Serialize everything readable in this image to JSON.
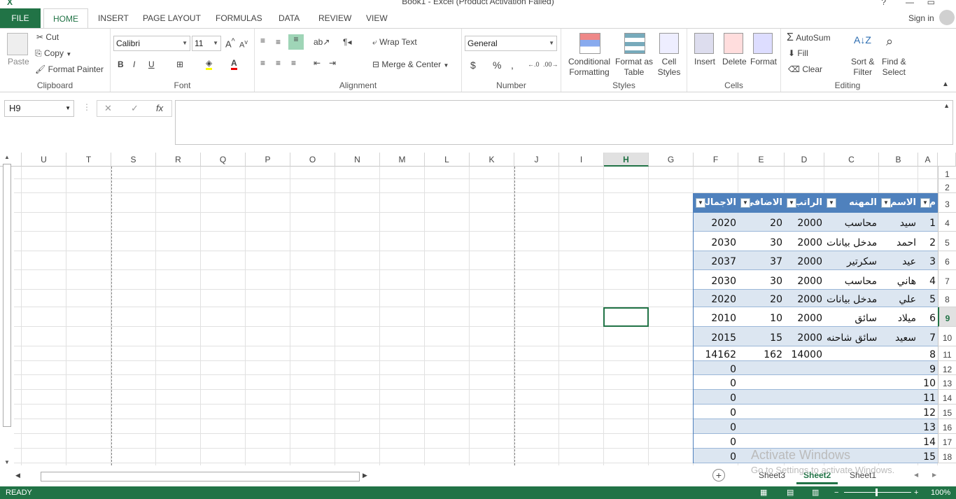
{
  "window": {
    "title": "Book1 - Excel (Product Activation Failed)"
  },
  "tabs": {
    "file": "FILE",
    "home": "HOME",
    "insert": "INSERT",
    "page_layout": "PAGE LAYOUT",
    "formulas": "FORMULAS",
    "data": "DATA",
    "review": "REVIEW",
    "view": "VIEW",
    "sign_in": "Sign in"
  },
  "ribbon": {
    "clipboard": {
      "label": "Clipboard",
      "paste": "Paste",
      "cut": "Cut",
      "copy": "Copy",
      "format_painter": "Format Painter"
    },
    "font": {
      "label": "Font",
      "family": "Calibri",
      "size": "11"
    },
    "alignment": {
      "label": "Alignment",
      "wrap": "Wrap Text",
      "merge": "Merge & Center"
    },
    "number": {
      "label": "Number",
      "format": "General"
    },
    "styles": {
      "label": "Styles",
      "cond1": "Conditional",
      "cond2": "Formatting",
      "fmt1": "Format as",
      "fmt2": "Table",
      "cell1": "Cell",
      "cell2": "Styles"
    },
    "cells": {
      "label": "Cells",
      "insert": "Insert",
      "delete": "Delete",
      "format": "Format"
    },
    "editing": {
      "label": "Editing",
      "autosum": "AutoSum",
      "fill": "Fill",
      "clear": "Clear",
      "sort1": "Sort &",
      "sort2": "Filter",
      "find1": "Find &",
      "find2": "Select"
    }
  },
  "formula_bar": {
    "name_box": "H9",
    "fx": "fx",
    "value": ""
  },
  "columns": [
    "U",
    "T",
    "S",
    "R",
    "Q",
    "P",
    "O",
    "N",
    "M",
    "L",
    "K",
    "J",
    "I",
    "H",
    "G",
    "F",
    "E",
    "D",
    "C",
    "B",
    "A"
  ],
  "rows": [
    "1",
    "2",
    "3",
    "4",
    "5",
    "6",
    "7",
    "8",
    "9",
    "10",
    "11",
    "12",
    "13",
    "14",
    "15",
    "16",
    "17",
    "18"
  ],
  "table": {
    "headers": [
      "م",
      "الاسم",
      "المهنه",
      "الراتب",
      "الاضافي",
      "الاجمالي"
    ],
    "rows": [
      [
        "1",
        "سيد",
        "محاسب",
        "2000",
        "20",
        "2020"
      ],
      [
        "2",
        "احمد",
        "مدخل بيانات",
        "2000",
        "30",
        "2030"
      ],
      [
        "3",
        "عيد",
        "سكرتير",
        "2000",
        "37",
        "2037"
      ],
      [
        "4",
        "هاني",
        "محاسب",
        "2000",
        "30",
        "2030"
      ],
      [
        "5",
        "علي",
        "مدخل بيانات",
        "2000",
        "20",
        "2020"
      ],
      [
        "6",
        "ميلاد",
        "سائق",
        "2000",
        "10",
        "2010"
      ],
      [
        "7",
        "سعيد",
        "سائق شاحنه",
        "2000",
        "15",
        "2015"
      ],
      [
        "8",
        "",
        "",
        "14000",
        "162",
        "14162"
      ],
      [
        "9",
        "",
        "",
        "",
        "",
        "0"
      ],
      [
        "10",
        "",
        "",
        "",
        "",
        "0"
      ],
      [
        "11",
        "",
        "",
        "",
        "",
        "0"
      ],
      [
        "12",
        "",
        "",
        "",
        "",
        "0"
      ],
      [
        "13",
        "",
        "",
        "",
        "",
        "0"
      ],
      [
        "14",
        "",
        "",
        "",
        "",
        "0"
      ],
      [
        "15",
        "",
        "",
        "",
        "",
        "0"
      ]
    ]
  },
  "sheets": [
    "Sheet3",
    "Sheet2",
    "Sheet1"
  ],
  "active_sheet": "Sheet2",
  "status": {
    "ready": "READY",
    "zoom": "100%"
  },
  "watermark": {
    "line1": "Activate Windows",
    "line2": "Go to Settings to activate Windows."
  },
  "colors": {
    "excel_green": "#217346",
    "table_header": "#4f81bd",
    "band": "#dce6f1"
  }
}
